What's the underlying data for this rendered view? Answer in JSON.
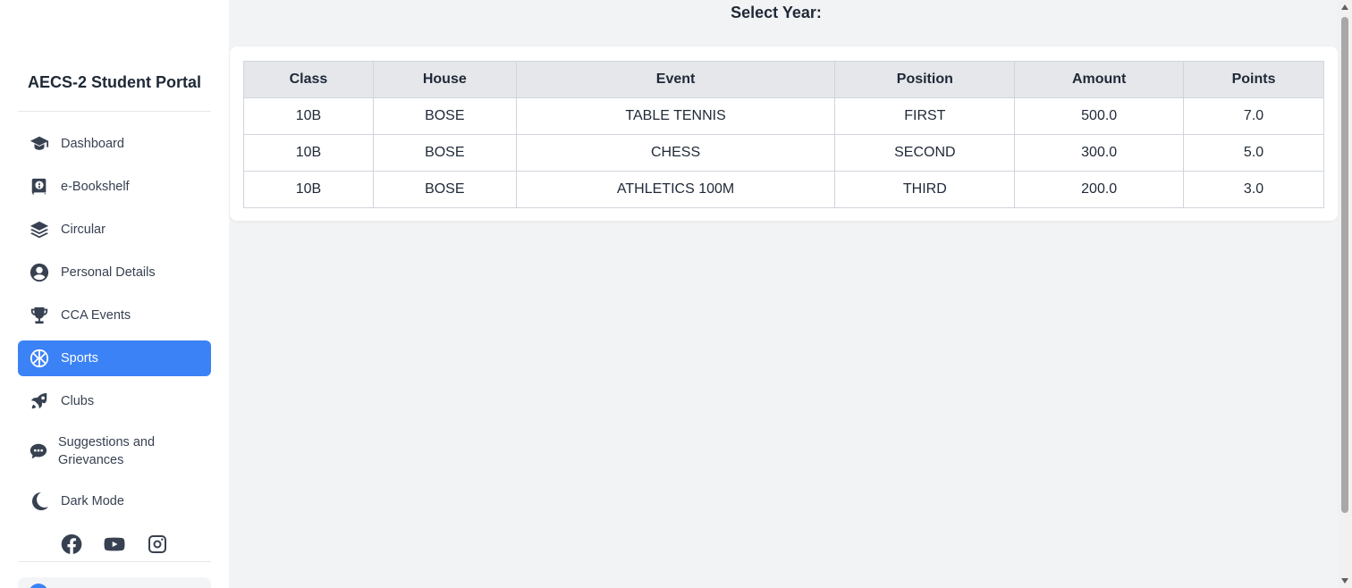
{
  "sidebar": {
    "title": "AECS-2 Student Portal",
    "items": [
      {
        "label": "Dashboard",
        "icon": "graduation-cap-icon"
      },
      {
        "label": "e-Bookshelf",
        "icon": "book-globe-icon"
      },
      {
        "label": "Circular",
        "icon": "layers-icon"
      },
      {
        "label": "Personal Details",
        "icon": "user-circle-icon"
      },
      {
        "label": "CCA Events",
        "icon": "trophy-icon"
      },
      {
        "label": "Sports",
        "icon": "basketball-icon",
        "active": true
      },
      {
        "label": "Clubs",
        "icon": "rocket-icon"
      },
      {
        "label": "Suggestions and Grievances",
        "icon": "chat-bubble-icon"
      },
      {
        "label": "Dark Mode",
        "icon": "moon-icon"
      }
    ],
    "social": [
      "facebook-icon",
      "youtube-icon",
      "instagram-icon"
    ]
  },
  "main": {
    "select_year_label": "Select Year:",
    "table": {
      "headers": [
        "Class",
        "House",
        "Event",
        "Position",
        "Amount",
        "Points"
      ],
      "rows": [
        [
          "10B",
          "BOSE",
          "TABLE TENNIS",
          "FIRST",
          "500.0",
          "7.0"
        ],
        [
          "10B",
          "BOSE",
          "CHESS",
          "SECOND",
          "300.0",
          "5.0"
        ],
        [
          "10B",
          "BOSE",
          "ATHLETICS 100M",
          "THIRD",
          "200.0",
          "3.0"
        ]
      ]
    }
  },
  "colors": {
    "accent": "#3b82f6",
    "background": "#f2f3f5",
    "header_bg": "#e5e7eb"
  }
}
